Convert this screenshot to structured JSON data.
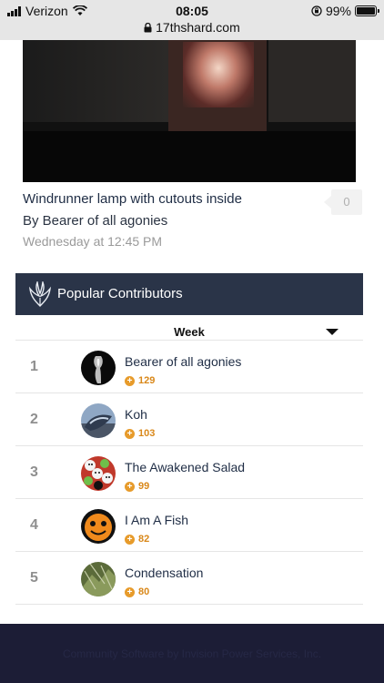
{
  "status_bar": {
    "carrier": "Verizon",
    "time": "08:05",
    "url": "17thshard.com",
    "battery": "99%",
    "battery_level": 0.99
  },
  "post": {
    "title": "Windrunner lamp with cutouts inside",
    "author": "By Bearer of all agonies",
    "date": "Wednesday at 12:45 PM",
    "comments": "0"
  },
  "widget": {
    "title": "Popular Contributors",
    "period": "Week",
    "contributors": [
      {
        "rank": "1",
        "name": "Bearer of all agonies",
        "rep": "129"
      },
      {
        "rank": "2",
        "name": "Koh",
        "rep": "103"
      },
      {
        "rank": "3",
        "name": "The Awakened Salad",
        "rep": "99"
      },
      {
        "rank": "4",
        "name": "I Am A Fish",
        "rep": "82"
      },
      {
        "rank": "5",
        "name": "Condensation",
        "rep": "80"
      }
    ]
  },
  "footer": {
    "text": "Community Software by Invision Power Services, Inc."
  },
  "colors": {
    "widget_header": "#2a3448",
    "accent_orange": "#e79b2b",
    "footer_bg": "#1c1d36",
    "status_bar_bg": "#e6e6e6"
  },
  "icons": [
    "signal-icon",
    "wifi-icon",
    "lock-icon",
    "rotation-lock-icon",
    "battery-icon",
    "site-logo-icon",
    "dropdown-caret-icon",
    "reputation-plus-icon"
  ]
}
